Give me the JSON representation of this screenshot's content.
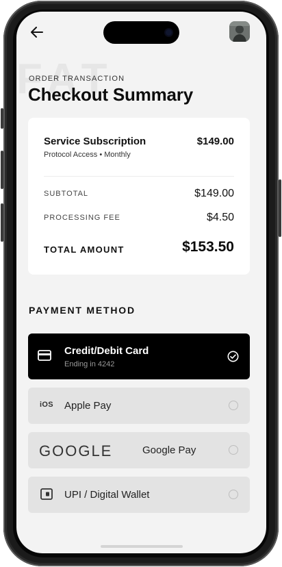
{
  "header": {
    "eyebrow": "ORDER TRANSACTION",
    "title": "Checkout Summary",
    "watermark": "FAT"
  },
  "summary": {
    "item_name": "Service Subscription",
    "item_sub": "Protocol Access • Monthly",
    "item_price": "$149.00",
    "subtotal_label": "SUBTOTAL",
    "subtotal_value": "$149.00",
    "fee_label": "PROCESSING FEE",
    "fee_value": "$4.50",
    "total_label": "TOTAL AMOUNT",
    "total_value": "$153.50"
  },
  "payment": {
    "section_title": "PAYMENT METHOD",
    "options": [
      {
        "label": "Credit/Debit Card",
        "sub": "Ending in 4242",
        "icon": "credit-card-icon",
        "selected": true
      },
      {
        "label": "Apple Pay",
        "mark": "iOS",
        "icon": "ios-icon",
        "selected": false
      },
      {
        "label": "Google Pay",
        "mark": "GOOGLE",
        "icon": "google-logo",
        "selected": false
      },
      {
        "label": "UPI / Digital Wallet",
        "icon": "wallet-icon",
        "selected": false
      }
    ]
  },
  "colors": {
    "screen_bg": "#f3f3f3",
    "card_bg": "#ffffff",
    "selected_bg": "#000000",
    "option_bg": "#e3e3e3"
  }
}
